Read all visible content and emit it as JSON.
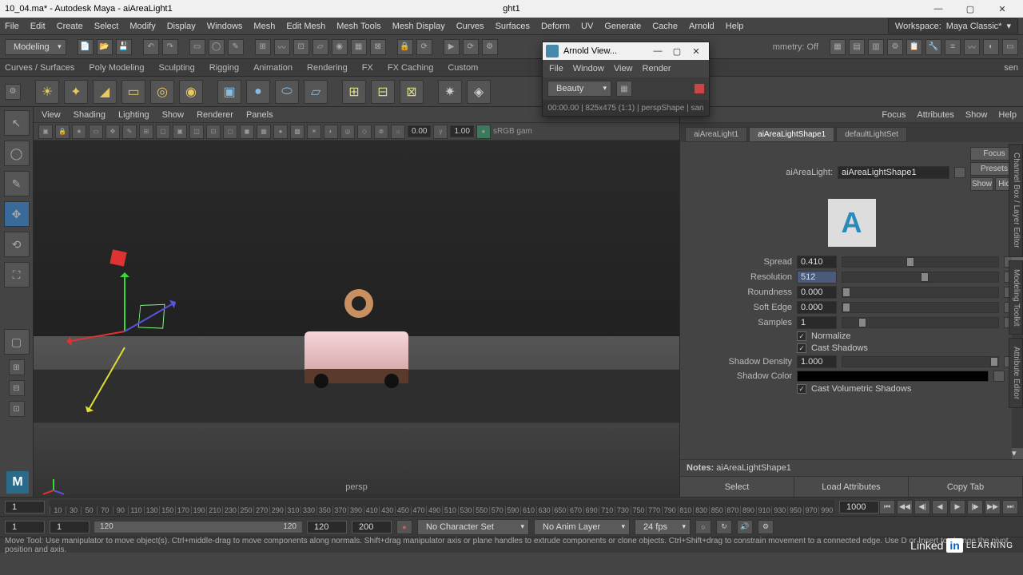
{
  "window": {
    "title_left": "10_04.ma* - Autodesk Maya - aiAreaLight1",
    "title_center": "ght1"
  },
  "menubar": [
    "File",
    "Edit",
    "Create",
    "Select",
    "Modify",
    "Display",
    "Windows",
    "Mesh",
    "Edit Mesh",
    "Mesh Tools",
    "Mesh Display",
    "Curves",
    "Surfaces",
    "Deform",
    "UV",
    "Generate",
    "Cache",
    "Arnold",
    "Help"
  ],
  "workspace": {
    "label": "Workspace:",
    "value": "Maya Classic*"
  },
  "toolbar": {
    "mode": "Modeling",
    "symmetry": "mmetry: Off"
  },
  "shelf_tabs": [
    "Curves / Surfaces",
    "Poly Modeling",
    "Sculpting",
    "Rigging",
    "Animation",
    "Rendering",
    "FX",
    "FX Caching",
    "Custom"
  ],
  "viewport": {
    "menus": [
      "View",
      "Shading",
      "Lighting",
      "Show",
      "Renderer",
      "Panels"
    ],
    "near": "0.00",
    "focal": "1.00",
    "space": "sRGB gam",
    "camera": "persp"
  },
  "attribute_panel": {
    "menus": [
      "Focus",
      "Attributes",
      "Show",
      "Help"
    ],
    "tabs": [
      "aiAreaLight1",
      "aiAreaLightShape1",
      "defaultLightSet"
    ],
    "active_tab": 1,
    "buttons": {
      "focus": "Focus",
      "presets": "Presets",
      "show": "Show",
      "hide": "Hide"
    },
    "node_label": "aiAreaLight:",
    "node_value": "aiAreaLightShape1",
    "rows": {
      "spread": {
        "label": "Spread",
        "value": "0.410",
        "thumb": 41
      },
      "resolution": {
        "label": "Resolution",
        "value": "512",
        "thumb": 50,
        "selected": true
      },
      "roundness": {
        "label": "Roundness",
        "value": "0.000",
        "thumb": 0
      },
      "soft_edge": {
        "label": "Soft Edge",
        "value": "0.000",
        "thumb": 0
      },
      "samples": {
        "label": "Samples",
        "value": "1",
        "thumb": 10
      },
      "normalize": {
        "label": "Normalize",
        "checked": true
      },
      "cast_shadows": {
        "label": "Cast Shadows",
        "checked": true
      },
      "shadow_density": {
        "label": "Shadow Density",
        "value": "1.000",
        "thumb": 100
      },
      "shadow_color": {
        "label": "Shadow Color"
      },
      "cast_volumetric": {
        "label": "Cast Volumetric Shadows",
        "checked": true
      }
    },
    "notes_label": "Notes:",
    "notes_value": "aiAreaLightShape1",
    "footer": {
      "select": "Select",
      "load": "Load Attributes",
      "copy": "Copy Tab"
    }
  },
  "side_tabs": [
    "Channel Box / Layer Editor",
    "Modeling Toolkit",
    "Attribute Editor"
  ],
  "timeline": {
    "start": "1",
    "end": "1000",
    "ticks": [
      "10",
      "30",
      "50",
      "70",
      "90",
      "110",
      "130",
      "150",
      "170",
      "190",
      "210",
      "230",
      "250",
      "270",
      "290",
      "310",
      "330",
      "350",
      "370",
      "390",
      "410",
      "430",
      "450",
      "470",
      "490",
      "510",
      "530",
      "550",
      "570",
      "590",
      "610",
      "630",
      "650",
      "670",
      "690",
      "710",
      "730",
      "750",
      "770",
      "790",
      "810",
      "830",
      "850",
      "870",
      "890",
      "910",
      "930",
      "950",
      "970",
      "990"
    ]
  },
  "range": {
    "start": "1",
    "end": "1",
    "range_start": "120",
    "range_end": "120",
    "current": "120",
    "total": "200",
    "char_set": "No Character Set",
    "anim_layer": "No Anim Layer",
    "fps": "24 fps"
  },
  "status": "Move Tool: Use manipulator to move object(s). Ctrl+middle-drag to move components along normals. Shift+drag manipulator axis or plane handles to extrude components or clone objects. Ctrl+Shift+drag to constrain movement to a connected edge. Use D or Insert to change the pivot position and axis.",
  "arnold": {
    "title": "Arnold View...",
    "menus": [
      "File",
      "Window",
      "View",
      "Render"
    ],
    "aov": "Beauty",
    "status": "00:00.00 | 825x475 (1:1) | perspShape | san"
  },
  "watermark": {
    "learning": "LEARNING"
  }
}
